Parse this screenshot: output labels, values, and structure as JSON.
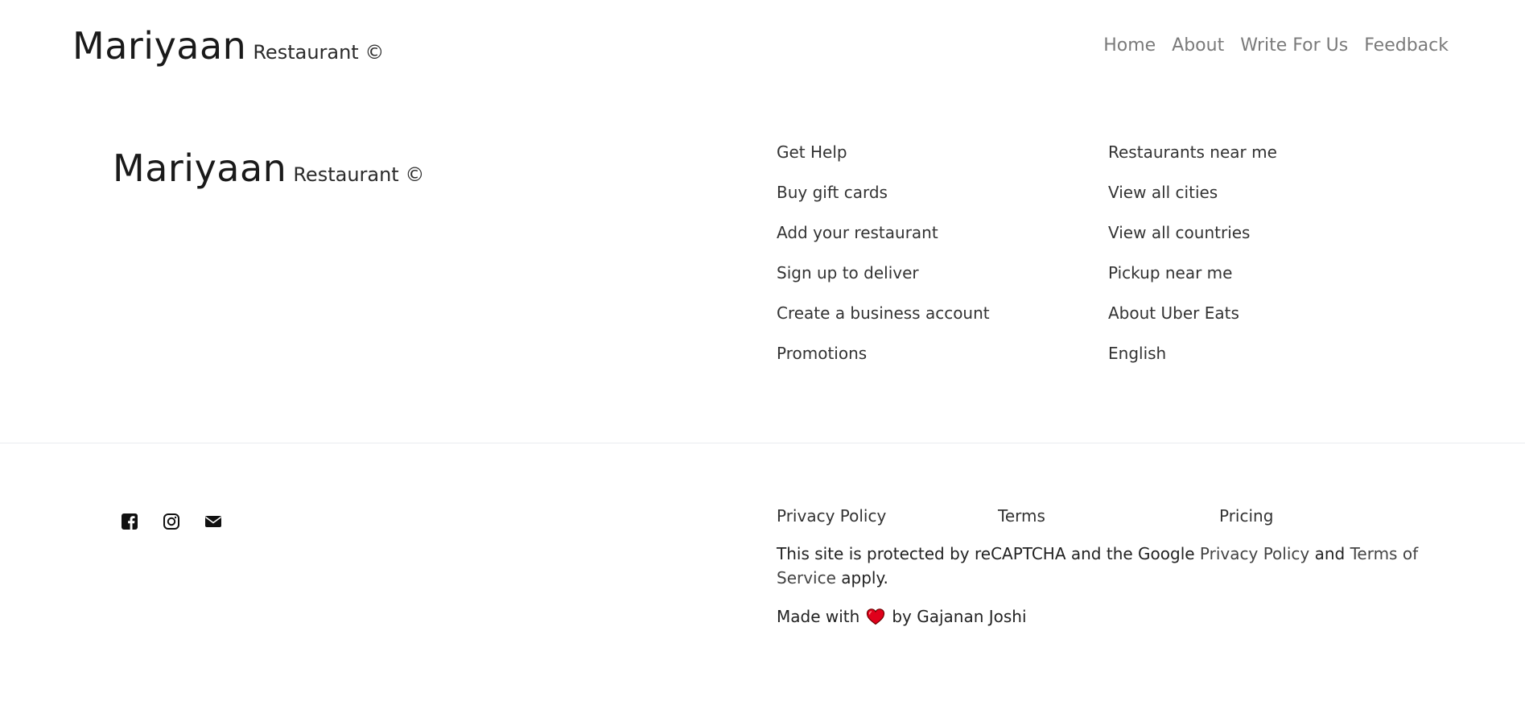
{
  "navbar": {
    "brand_name": "Mariyaan",
    "brand_suffix": "Restaurant ©",
    "links": [
      "Home",
      "About",
      "Write For Us",
      "Feedback"
    ]
  },
  "footer": {
    "brand_name": "Mariyaan",
    "brand_suffix": "Restaurant ©",
    "column_1": [
      "Get Help",
      "Buy gift cards",
      "Add your restaurant",
      "Sign up to deliver",
      "Create a business account",
      "Promotions"
    ],
    "column_2": [
      "Restaurants near me",
      "View all cities",
      "View all countries",
      "Pickup near me",
      "About Uber Eats",
      "English"
    ],
    "social_icons": [
      "facebook-icon",
      "instagram-icon",
      "envelope-icon"
    ],
    "legal_links": [
      "Privacy Policy",
      "Terms",
      "Pricing"
    ],
    "recaptcha": {
      "part_1": "This site is protected by reCAPTCHA and the Google ",
      "privacy_link": "Privacy Policy",
      "part_2": " and ",
      "terms_link": "Terms of Service",
      "part_3": " apply."
    },
    "made_with": {
      "prefix": "Made with",
      "icon": "heart-icon",
      "suffix": "by Gajanan Joshi"
    }
  },
  "colors": {
    "nav_link": "#7a7a7a",
    "text": "#212529",
    "heart": "#e0001b",
    "divider": "#e9ecef"
  }
}
